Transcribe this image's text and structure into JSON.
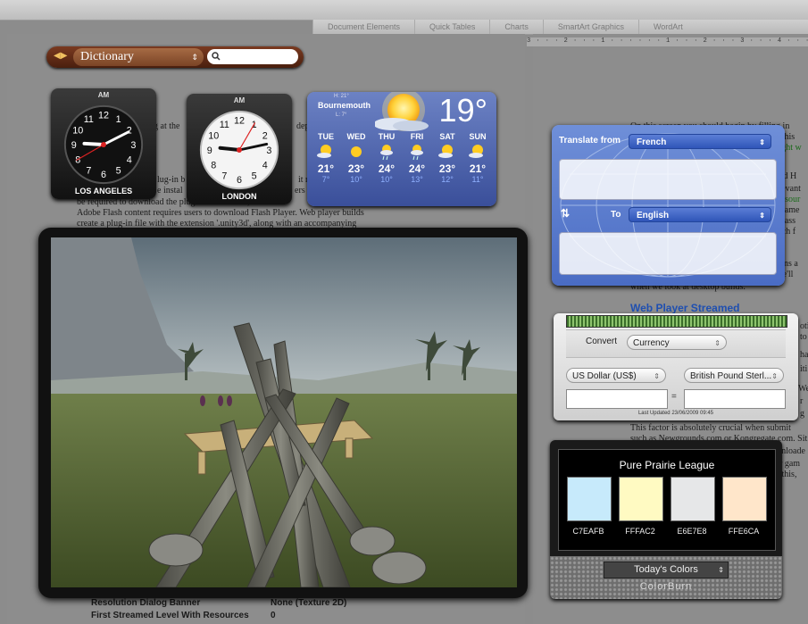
{
  "ribbon": {
    "tabs": [
      "Document Elements",
      "Quick Tables",
      "Charts",
      "SmartArt Graphics",
      "WordArt"
    ]
  },
  "ruler": {
    "text": "3 · · · 2 · · · 1 · · · · · · 1 · · · 2 · · · 3 · · · 4 · · · 5 · · · 6 · · · 7"
  },
  "document_left": {
    "lines": [
      "g at the",
      "dep",
      "lug-in b",
      "it r",
      "e instal",
      "ers",
      "be required to download the plug-in beforehand, in t",
      "Adobe Flash content requires users to download Flash Player. Web player builds",
      "create a plug-in file with the extension '.unity3d', along with an accompanying"
    ],
    "table_rows": [
      {
        "label": "Resolution Dialog Banner",
        "value": "None (Texture 2D)"
      },
      {
        "label": "First Streamed Level With Resources",
        "value": "0"
      }
    ]
  },
  "document_right": {
    "lines_top": [
      "On this screen you should begin by filling in",
      "at this",
      "eight w",
      "and H",
      "elevant",
      "Resour",
      "r game",
      "of ass",
      "hich f"
    ],
    "lines_mid": [
      "tains a",
      "We'll",
      "when we look at desktop builds."
    ],
    "heading": "Web Player Streamed",
    "lines_mid2": [
      "oti",
      "to",
      "ha",
      "iti",
      "We",
      "r",
      "g"
    ],
    "lines_bottom": [
      "This factor is absolutely crucial when submit",
      "such as Newgrounds.com or Kongregate.com. Sit",
      "wnloade",
      "ur gam",
      "n this,"
    ]
  },
  "dictionary": {
    "source": "Dictionary",
    "search_placeholder": ""
  },
  "clocks": [
    {
      "ampm": "AM",
      "city": "LOS ANGELES",
      "hour": 9.1,
      "minute": 10.5,
      "second": 40,
      "theme": "dark"
    },
    {
      "ampm": "AM",
      "city": "LONDON",
      "hour": 9.2,
      "minute": 13.0,
      "second": 5,
      "theme": "light"
    }
  ],
  "weather": {
    "city": "Bournemouth",
    "hi": "H: 21°",
    "lo": "L: 7°",
    "current": "19°",
    "days": [
      {
        "day": "TUE",
        "hi": "21°",
        "lo": "7°",
        "icon": "sun-cloud-icon"
      },
      {
        "day": "WED",
        "hi": "23°",
        "lo": "10°",
        "icon": "sun-icon"
      },
      {
        "day": "THU",
        "hi": "24°",
        "lo": "10°",
        "icon": "sun-rain-icon"
      },
      {
        "day": "FRI",
        "hi": "24°",
        "lo": "13°",
        "icon": "sun-rain-icon"
      },
      {
        "day": "SAT",
        "hi": "23°",
        "lo": "12°",
        "icon": "sun-cloud-icon"
      },
      {
        "day": "SUN",
        "hi": "21°",
        "lo": "11°",
        "icon": "sun-cloud-icon"
      }
    ]
  },
  "translate": {
    "from_label": "Translate from",
    "from_lang": "French",
    "to_label": "To",
    "to_lang": "English",
    "swap_icon": "swap-icon"
  },
  "currency": {
    "convert_label": "Convert",
    "convert_type": "Currency",
    "from_currency": "US Dollar (US$)",
    "to_currency": "British Pound Sterl...",
    "equals": "=",
    "updated": "Last Updated 23/06/2009 09:45"
  },
  "colorburn": {
    "title": "Pure Prairie League",
    "swatches": [
      {
        "hex": "#C7EAFB",
        "label": "C7EAFB"
      },
      {
        "hex": "#FFFAC2",
        "label": "FFFAC2"
      },
      {
        "hex": "#E6E7E8",
        "label": "E6E7E8"
      },
      {
        "hex": "#FFE6CA",
        "label": "FFE6CA"
      }
    ],
    "selector": "Today's Colors",
    "brand": "ColorBurn"
  }
}
